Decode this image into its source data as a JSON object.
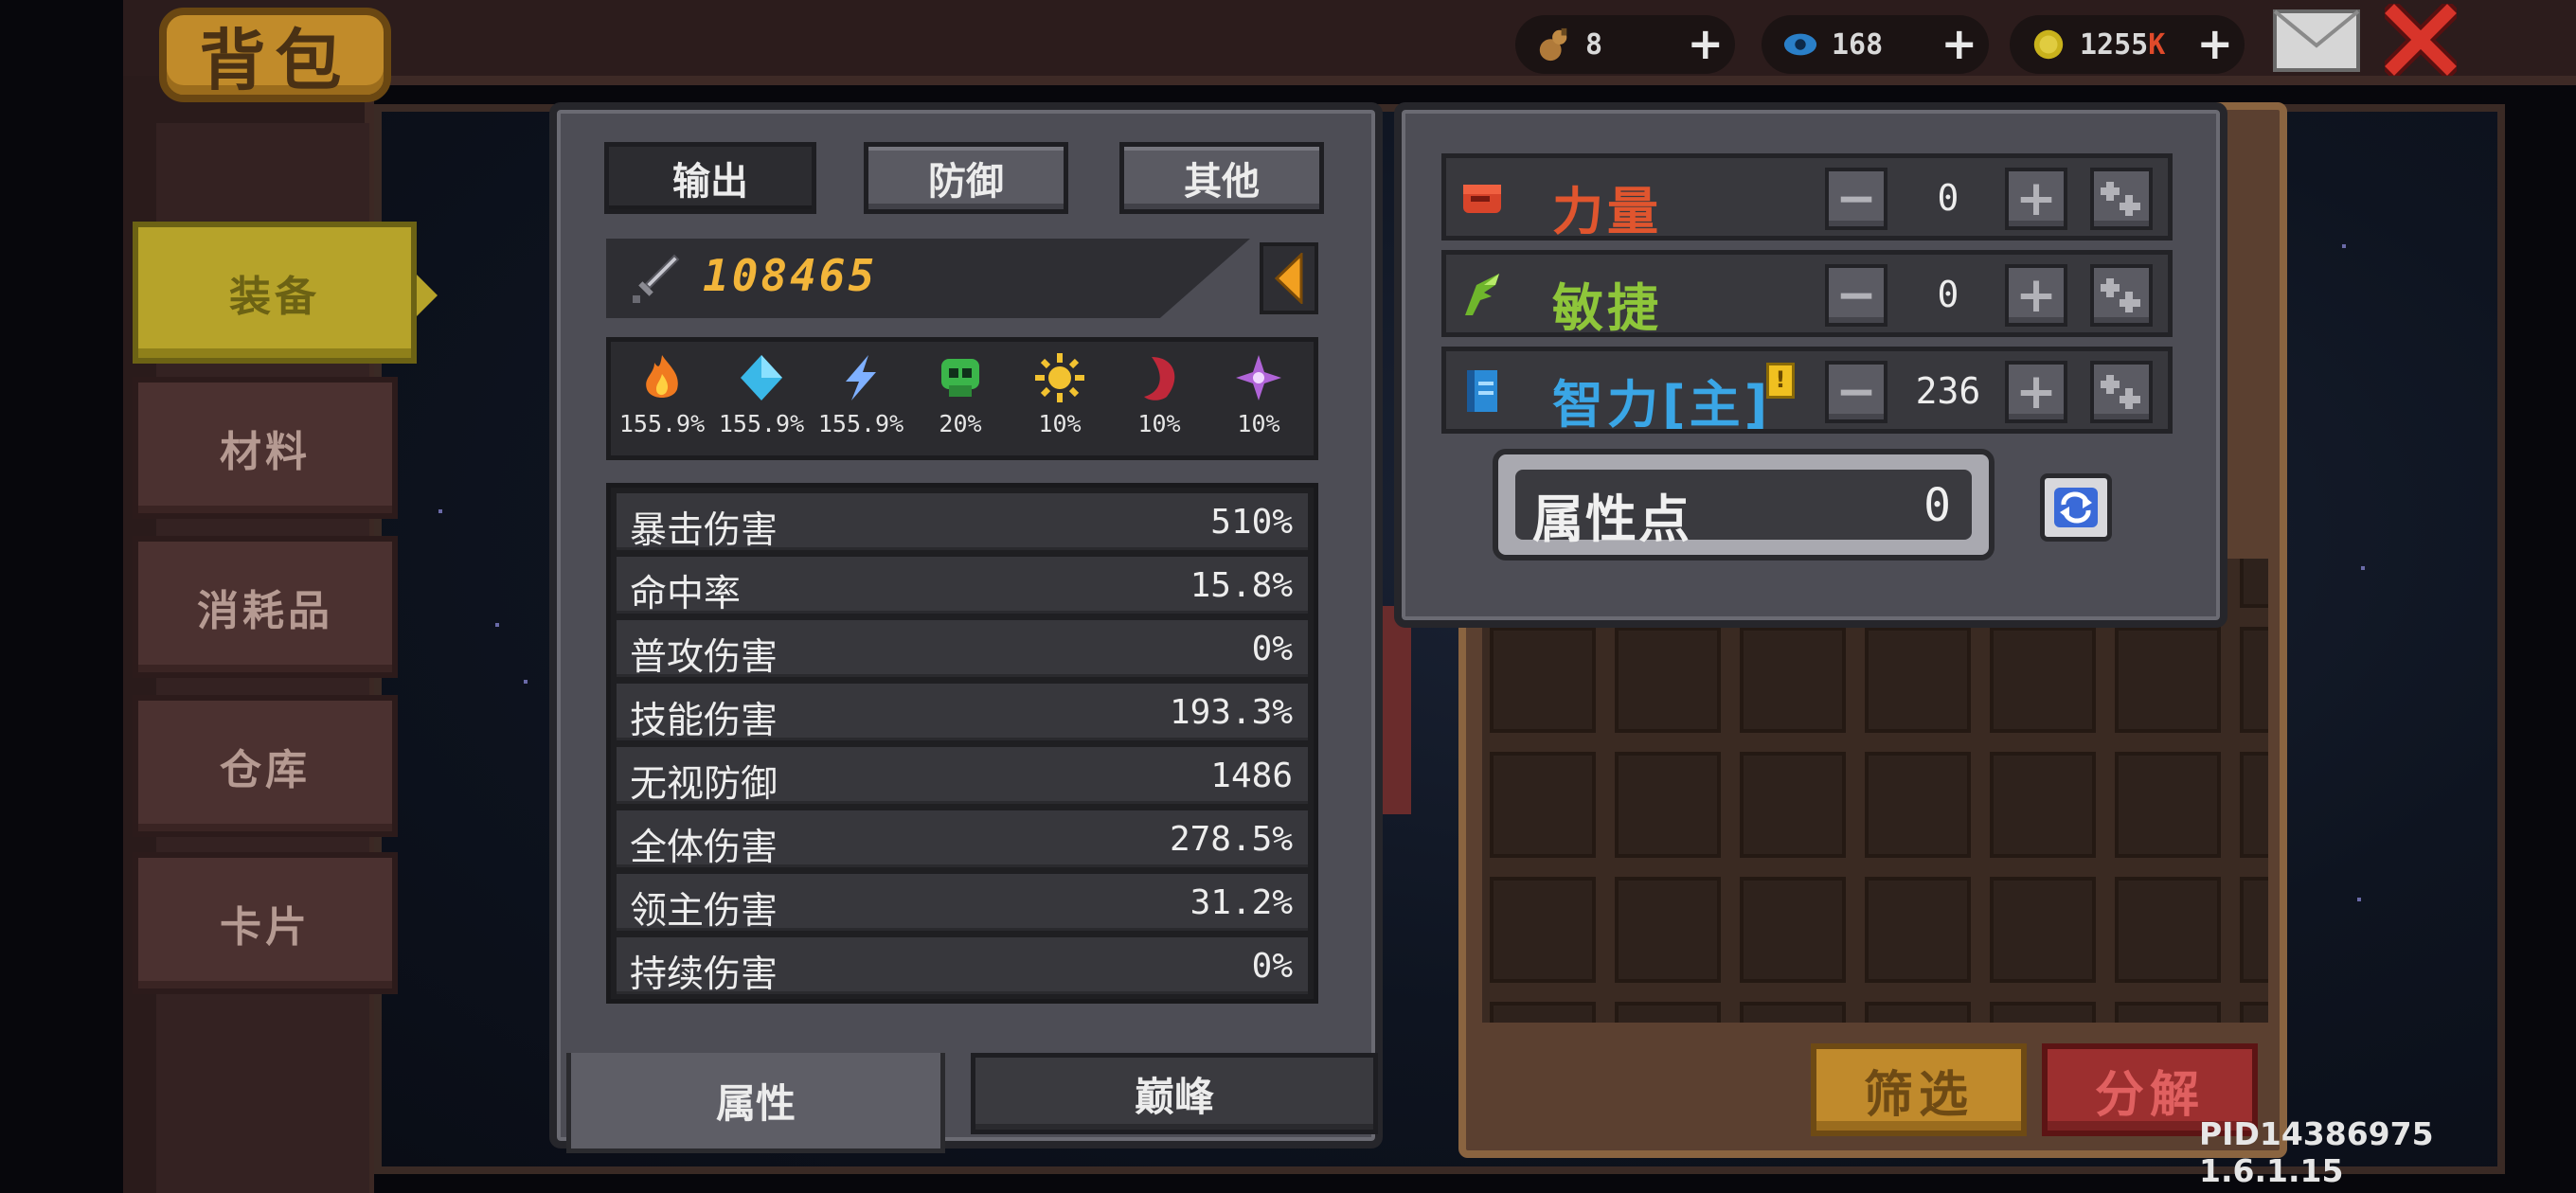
{
  "title": "背包",
  "currencies": [
    {
      "name": "gourd-icon",
      "value": "8",
      "suffix": ""
    },
    {
      "name": "eye-gem-icon",
      "value": "168",
      "suffix": ""
    },
    {
      "name": "gold-coin-icon",
      "value": "1255",
      "suffix": "K"
    }
  ],
  "side_tabs": [
    "装备",
    "材料",
    "消耗品",
    "仓库",
    "卡片"
  ],
  "stats_tabs": [
    "输出",
    "防御",
    "其他"
  ],
  "power": "108465",
  "elements": [
    {
      "icon": "fire-icon",
      "value": "155.9%",
      "color": "#f07a20"
    },
    {
      "icon": "ice-crystal-icon",
      "value": "155.9%",
      "color": "#3ab8e8"
    },
    {
      "icon": "lightning-icon",
      "value": "155.9%",
      "color": "#7fb0ff"
    },
    {
      "icon": "poison-skull-icon",
      "value": "20%",
      "color": "#3bb54a"
    },
    {
      "icon": "light-sun-icon",
      "value": "10%",
      "color": "#f2c230"
    },
    {
      "icon": "dark-moon-icon",
      "value": "10%",
      "color": "#c0283a"
    },
    {
      "icon": "arcane-star-icon",
      "value": "10%",
      "color": "#b064d8"
    }
  ],
  "stats": [
    {
      "name": "暴击伤害",
      "value": "510%"
    },
    {
      "name": "命中率",
      "value": "15.8%"
    },
    {
      "name": "普攻伤害",
      "value": "0%"
    },
    {
      "name": "技能伤害",
      "value": "193.3%"
    },
    {
      "name": "无视防御",
      "value": "1486"
    },
    {
      "name": "全体伤害",
      "value": "278.5%"
    },
    {
      "name": "领主伤害",
      "value": "31.2%"
    },
    {
      "name": "持续伤害",
      "value": "0%"
    }
  ],
  "bottom_tabs": [
    "属性",
    "巅峰"
  ],
  "attributes": [
    {
      "name": "力量",
      "value": "0",
      "color": "#e0552e",
      "icon": "fist-icon"
    },
    {
      "name": "敏捷",
      "value": "0",
      "color": "#8ec63a",
      "icon": "feather-icon"
    },
    {
      "name": "智力[主]",
      "value": "236",
      "color": "#3aa6e6",
      "icon": "book-icon"
    }
  ],
  "main_badge": "!",
  "attribute_points": {
    "label": "属性点",
    "value": "0"
  },
  "buttons": {
    "filter": "筛选",
    "decompose": "分解"
  },
  "version": "PID14386975 1.6.1.15"
}
